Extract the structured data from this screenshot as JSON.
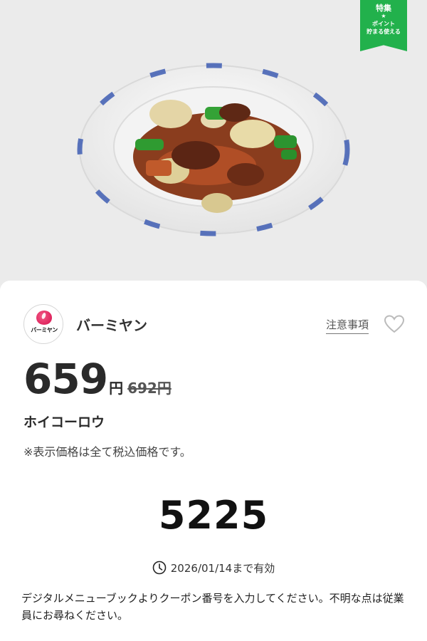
{
  "badge": {
    "title": "特集",
    "star": "★",
    "subtitle_1": "ポイント",
    "subtitle_2": "貯まる使える",
    "color": "#22b14c"
  },
  "hero": {
    "image_subject": "plate of twice-cooked pork with cabbage and green peppers"
  },
  "brand": {
    "name": "バーミヤン",
    "logo_text": "バーミヤン",
    "logo_color": "#d6104e"
  },
  "actions": {
    "notice_label": "注意事項",
    "favorite_icon": "heart-outline-icon"
  },
  "price": {
    "current": "659",
    "unit": "円",
    "original": "692円"
  },
  "item": {
    "name": "ホイコーロウ",
    "tax_note": "※表示価格は全て税込価格です。"
  },
  "coupon": {
    "code": "5225"
  },
  "validity": {
    "icon": "clock-icon",
    "text": "2026/01/14まで有効"
  },
  "instructions": "デジタルメニューブックよりクーポン番号を入力してください。不明な点は従業員にお尋ねください。"
}
